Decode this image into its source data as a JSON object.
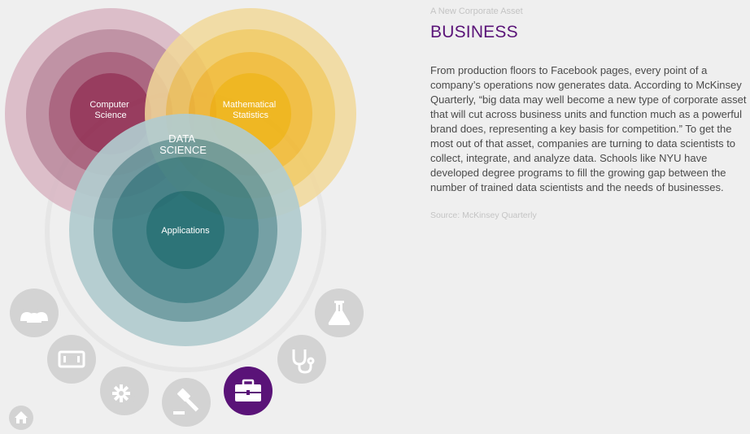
{
  "diagram": {
    "center_label": [
      "DATA",
      "SCIENCE"
    ],
    "circles": [
      {
        "id": "computer-science",
        "label": [
          "Computer",
          "Science"
        ],
        "colors": [
          "#d9b6c3",
          "#b88499",
          "#a0506e",
          "#8a1e46"
        ]
      },
      {
        "id": "mathematical-statistics",
        "label": [
          "Mathematical",
          "Statistics"
        ],
        "colors": [
          "#f2d99a",
          "#f2c95c",
          "#f2b72a",
          "#f0ae00"
        ]
      },
      {
        "id": "applications",
        "label": [
          "Applications"
        ],
        "colors": [
          "#b2cccf",
          "#6b9a9f",
          "#3c7d83",
          "#1d6a6e"
        ]
      }
    ]
  },
  "nav": {
    "items": [
      {
        "id": "people",
        "icon": "people-icon",
        "active": false
      },
      {
        "id": "finance",
        "icon": "money-icon",
        "active": false
      },
      {
        "id": "technology",
        "icon": "gears-icon",
        "active": false
      },
      {
        "id": "law",
        "icon": "gavel-icon",
        "active": false
      },
      {
        "id": "business",
        "icon": "briefcase-icon",
        "active": true
      },
      {
        "id": "health",
        "icon": "stethoscope-icon",
        "active": false
      },
      {
        "id": "science",
        "icon": "flask-icon",
        "active": false
      }
    ],
    "home_icon": "home-icon",
    "inactive_color": "#d3d3d3",
    "active_color": "#5a1378"
  },
  "info": {
    "eyebrow": "A New Corporate Asset",
    "title": "BUSINESS",
    "body": "From production floors to Facebook pages, every point of a company’s operations now generates data. According to McKinsey Quarterly, “big data may well become a new type of corporate asset that will cut across business units and function much as a powerful brand does, representing a key basis for competition.” To get the most out of that asset, companies are turning to data scientists to collect, integrate, and analyze data. Schools like NYU have developed degree programs to fill the growing gap between the number of trained data scientists and the needs of businesses.",
    "source": "Source: McKinsey Quarterly"
  }
}
